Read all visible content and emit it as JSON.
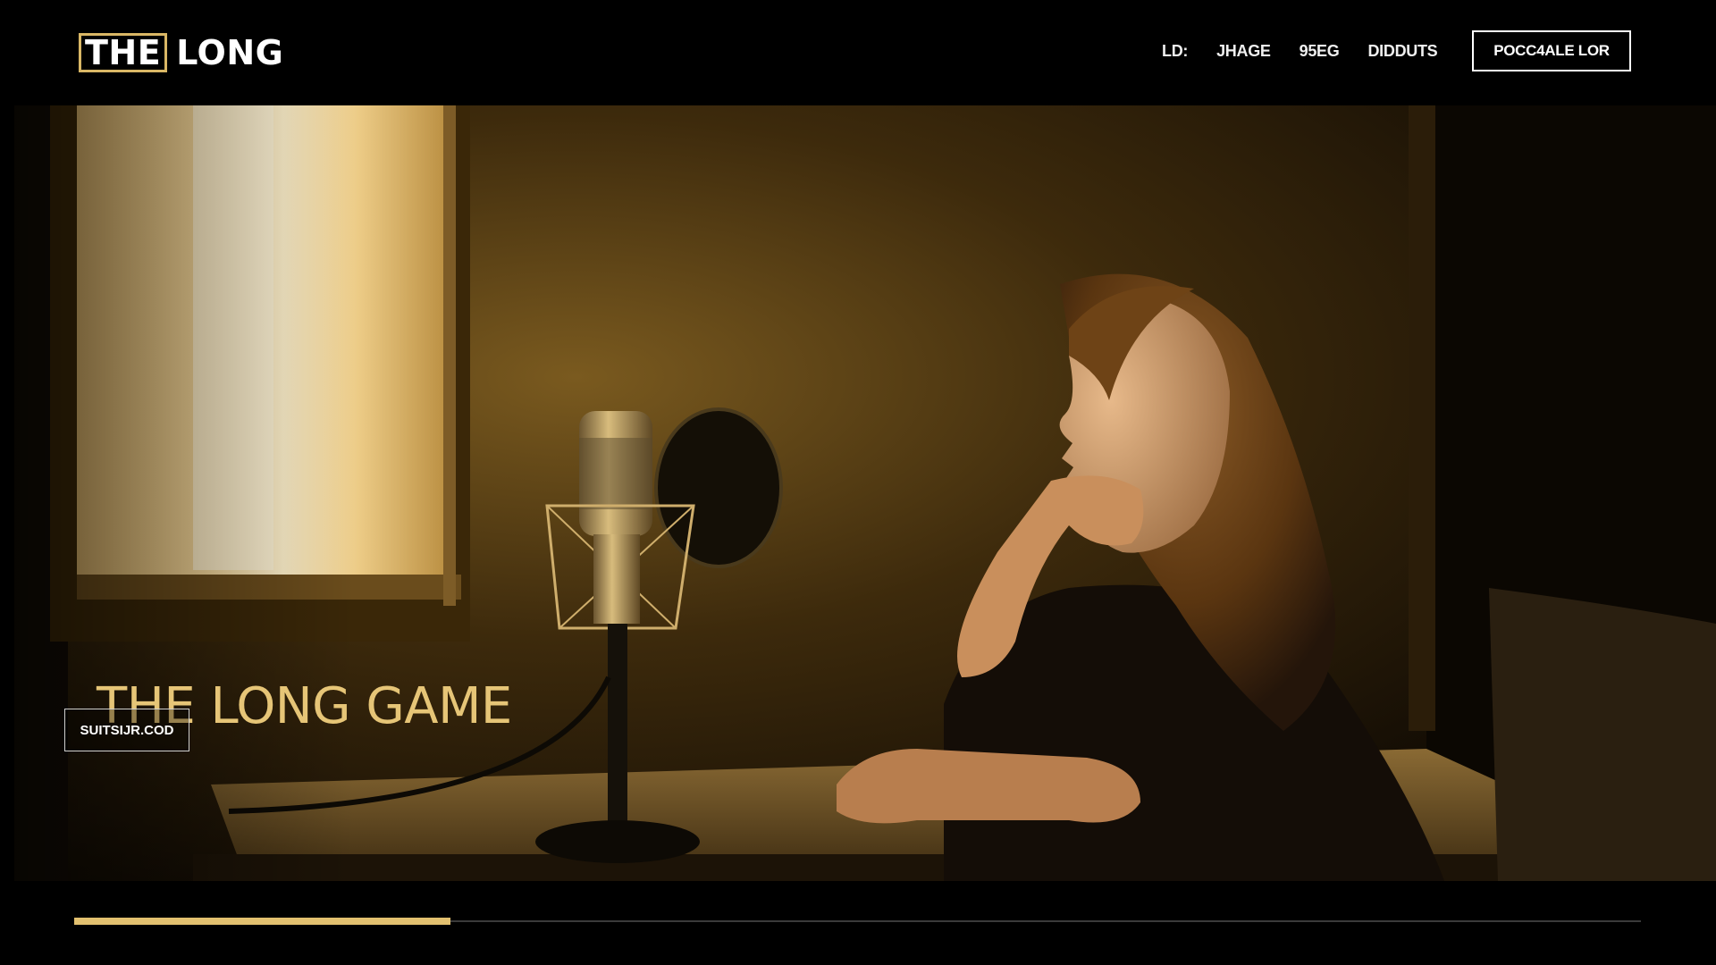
{
  "header": {
    "logo_part1": "THE",
    "logo_part2": "LONG",
    "nav": [
      {
        "label": "LD:"
      },
      {
        "label": "JHAGE"
      },
      {
        "label": "95EG"
      },
      {
        "label": "DIDDUTS"
      }
    ],
    "cta_label": "POCC4ALE LOR"
  },
  "hero": {
    "title": "THE LONG GAME",
    "button_label": "SUITSIJR.COD"
  },
  "progress": {
    "value": 0.24
  },
  "colors": {
    "accent": "#e2c06f",
    "background": "#000000"
  }
}
